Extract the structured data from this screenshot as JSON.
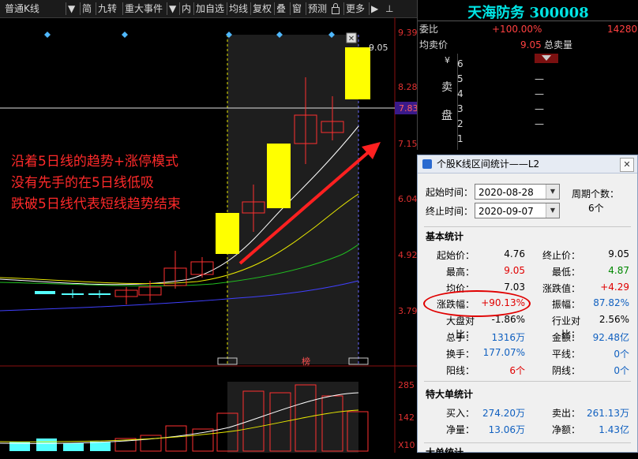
{
  "toolbar": {
    "items": [
      "普通K线",
      "▼",
      "简",
      "九转",
      "重大事件",
      "▼",
      "内",
      "加自选",
      "均线",
      "复权",
      "叠",
      "窗",
      "预测",
      "更多",
      "▶"
    ],
    "lock_icon": "lock-icon",
    "pin_icon": "pin-icon"
  },
  "price_axis": {
    "labels": [
      "9.39",
      "8.28",
      "7.83",
      "7.15",
      "6.04",
      "4.92",
      "3.79"
    ],
    "current_price": "7.83",
    "high_label": "9.05",
    "volume_labels": [
      "285",
      "142",
      "X10"
    ]
  },
  "markers": {
    "board_tag": "榜",
    "close_glyph": "✕"
  },
  "annotation": {
    "lines": [
      "沿着5日线的趋势+涨停模式",
      "没有先手的在5日线低吸",
      "跌破5日线代表短线趋势结束"
    ],
    "color": "#ff2a2a"
  },
  "quote": {
    "stock_title": "天海防务 300008",
    "wei_bi_label": "委比",
    "wei_bi_value": "+100.00%",
    "wei_bi_volume": "14280",
    "avg_price_label": "均卖价",
    "avg_price_value": "9.05",
    "total_sell_label": "总卖量",
    "sell_levels": [
      "6",
      "5",
      "4",
      "3",
      "2",
      "1"
    ],
    "sell_side_chars": [
      "卖",
      "盘"
    ],
    "sell_marker": "¥",
    "dash": "—"
  },
  "dialog": {
    "title": "个股K线区间统计——L2",
    "start_label": "起始时间：",
    "start_value": "2020-08-28",
    "end_label": "终止时间：",
    "end_value": "2020-09-07",
    "period_label": "周期个数：",
    "period_value": "6个",
    "basic_title": "基本统计",
    "basic": [
      {
        "l1": "起始价：",
        "v1": "4.76",
        "c1": "blk",
        "l2": "终止价：",
        "v2": "9.05",
        "c2": "blk"
      },
      {
        "l1": "最高：",
        "v1": "9.05",
        "c1": "red",
        "l2": "最低：",
        "v2": "4.87",
        "c2": "green"
      },
      {
        "l1": "均价：",
        "v1": "7.03",
        "c1": "blk",
        "l2": "涨跌值：",
        "v2": "+4.29",
        "c2": "red"
      },
      {
        "l1": "涨跌幅：",
        "v1": "+90.13%",
        "c1": "red",
        "l2": "振幅：",
        "v2": "87.82%",
        "c2": "blue"
      },
      {
        "l1": "大盘对比：",
        "v1": "-1.86%",
        "c1": "blk",
        "l2": "行业对比：",
        "v2": "2.56%",
        "c2": "blk"
      },
      {
        "l1": "总手：",
        "v1": "1316万",
        "c1": "blue",
        "l2": "金额：",
        "v2": "92.48亿",
        "c2": "blue"
      },
      {
        "l1": "换手：",
        "v1": "177.07%",
        "c1": "blue",
        "l2": "平线：",
        "v2": "0个",
        "c2": "blue"
      },
      {
        "l1": "阳线：",
        "v1": "6个",
        "c1": "red",
        "l2": "阴线：",
        "v2": "0个",
        "c2": "blue"
      }
    ],
    "big_title": "特大单统计",
    "big": [
      {
        "l1": "买入：",
        "v1": "274.20万",
        "c1": "blue",
        "l2": "卖出：",
        "v2": "261.13万",
        "c2": "blue"
      },
      {
        "l1": "净量：",
        "v1": "13.06万",
        "c1": "blue",
        "l2": "净额：",
        "v2": "1.43亿",
        "c2": "blue"
      }
    ],
    "large_title": "大单统计"
  }
}
